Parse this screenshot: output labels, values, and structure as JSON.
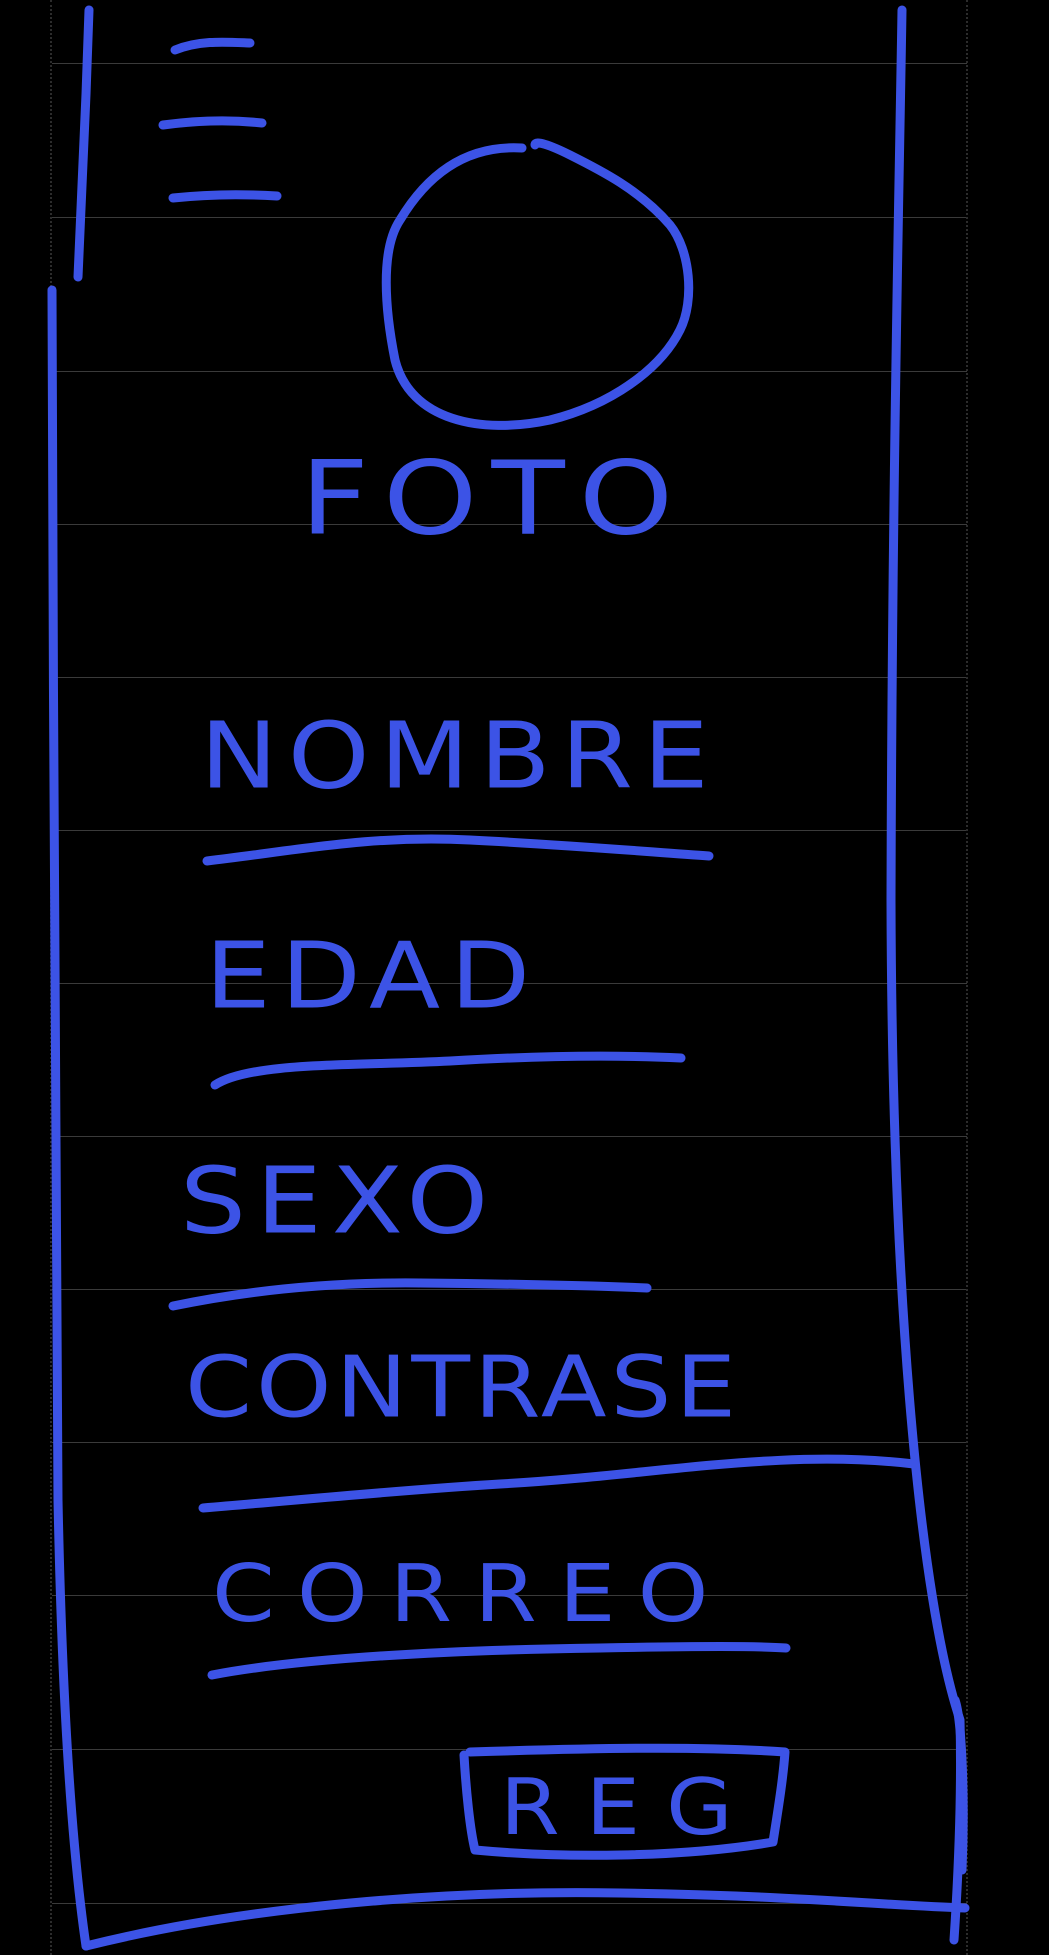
{
  "colors": {
    "background": "#000000",
    "ink": "#3c53e6",
    "rule": "#3a3a3a"
  },
  "menu": {
    "icon": "hamburger-menu-icon"
  },
  "photo": {
    "icon": "profile-photo-circle-icon",
    "label": "FOTO"
  },
  "form": {
    "fields": [
      {
        "label": "NOMBRE"
      },
      {
        "label": "EDAD"
      },
      {
        "label": "SEXO"
      },
      {
        "label": "CONTRASE"
      },
      {
        "label": "CORREO"
      }
    ],
    "submit_label": "REG"
  }
}
